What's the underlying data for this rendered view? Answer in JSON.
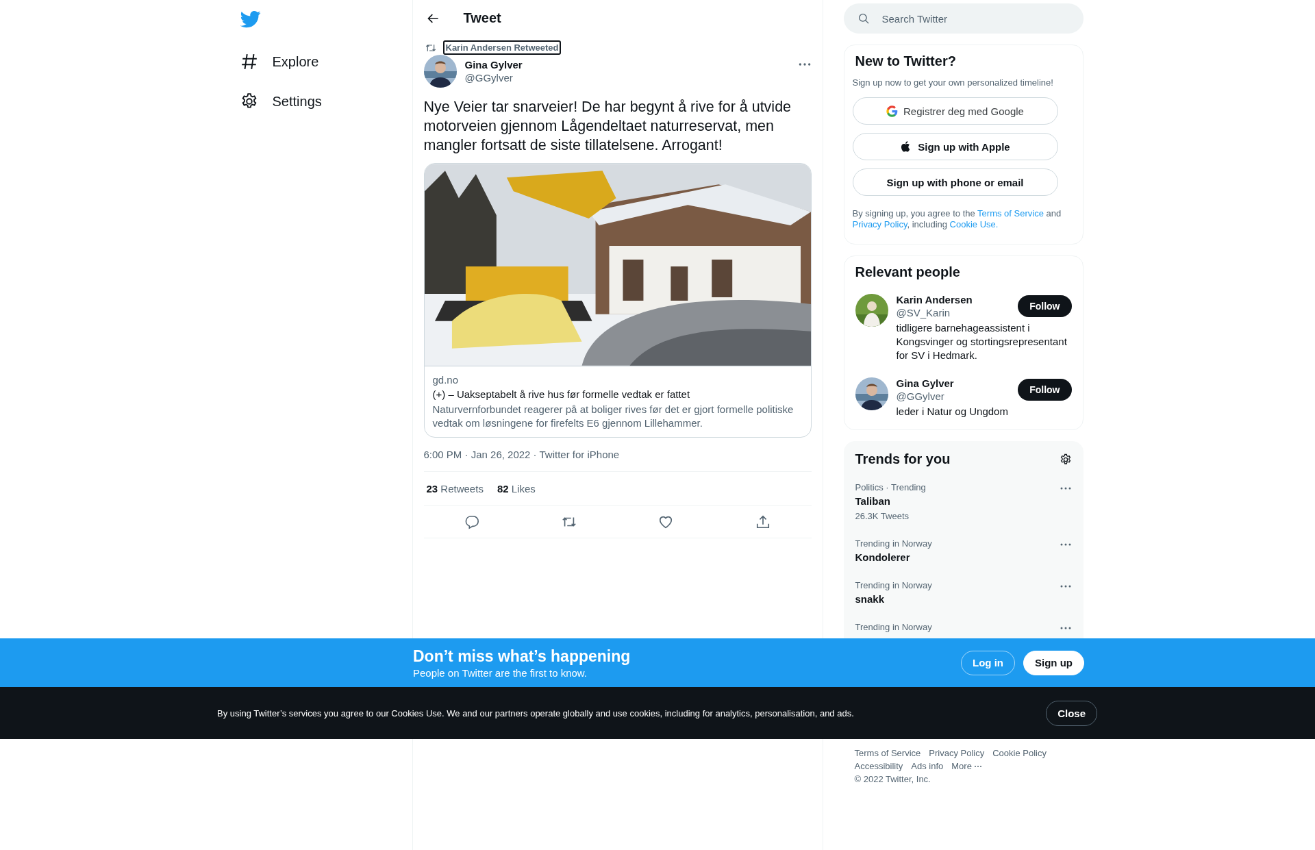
{
  "nav": {
    "items": [
      {
        "kind": "hashtag",
        "label": "Explore"
      },
      {
        "kind": "gear",
        "label": "Settings"
      }
    ]
  },
  "header": {
    "title": "Tweet"
  },
  "tweet": {
    "social_context": {
      "text": "Karin Andersen Retweeted",
      "focused": true
    },
    "author": {
      "name": "Gina Gylver",
      "handle": "@GGylver"
    },
    "text": "Nye Veier tar snarveier! De har begynt å rive for å utvide motorveien gjennom Lågendeltaet naturreservat, men mangler fortsatt de siste tillatelsene. Arrogant!",
    "card": {
      "domain": "gd.no",
      "title": "(+) – Uakseptabelt å rive hus før formelle vedtak er fattet",
      "description": "Naturvernforbundet reagerer på at boliger rives før det er gjort formelle politiske vedtak om løsningene for firefelts E6 gjennom Lillehammer."
    },
    "meta": "6:00 PM · Jan 26, 2022 · Twitter for iPhone",
    "stats": [
      "**23** Retweets",
      "**82** Likes"
    ]
  },
  "search": {
    "placeholder": "Search Twitter"
  },
  "signup": {
    "title": "New to Twitter?",
    "subtitle": "Sign up now to get your own personalized timeline!",
    "buttons": [
      {
        "kind": "google",
        "label": "Registrer deg med Google"
      },
      {
        "kind": "apple",
        "label": "Sign up with Apple"
      },
      {
        "kind": "plain",
        "label": "Sign up with phone or email"
      }
    ],
    "legal": [
      {
        "kind": "text",
        "text": "By signing up, you agree to the "
      },
      {
        "kind": "link",
        "text": "Terms of Service"
      },
      {
        "kind": "text",
        "text": " and "
      },
      {
        "kind": "link",
        "text": "Privacy Policy"
      },
      {
        "kind": "text",
        "text": ", including "
      },
      {
        "kind": "link",
        "text": "Cookie Use."
      }
    ]
  },
  "relevant_people": {
    "title": "Relevant people",
    "people": [
      {
        "name": "Karin Andersen",
        "handle": "@SV_Karin",
        "bio": "tidligere barnehageassistent i Kongsvinger og stortingsrepresentant for SV i Hedmark.",
        "follow": "Follow"
      },
      {
        "name": "Gina Gylver",
        "handle": "@GGylver",
        "bio": "leder i Natur og Ungdom",
        "follow": "Follow"
      }
    ]
  },
  "trends": {
    "title": "Trends for you",
    "items": [
      {
        "context": "Politics · Trending",
        "topic": "Taliban",
        "count": "26.3K Tweets"
      },
      {
        "context": "Trending in Norway",
        "topic": "Kondolerer"
      },
      {
        "context": "Trending in Norway",
        "topic": "snakk"
      },
      {
        "context": "Trending in Norway"
      }
    ]
  },
  "footer": {
    "links": [
      "Terms of Service",
      "Privacy Policy",
      "Cookie Policy",
      "Accessibility",
      "Ads info",
      "More"
    ],
    "copyright": "© 2022 Twitter, Inc."
  },
  "banner": {
    "title": "Don’t miss what’s happening",
    "subtitle": "People on Twitter are the first to know.",
    "buttons": [
      {
        "kind": "outline",
        "label": "Log in"
      },
      {
        "kind": "filled",
        "label": "Sign up"
      }
    ]
  },
  "cookie": {
    "text": "By using Twitter’s services you agree to our Cookies Use. We and our partners operate globally and use cookies, including for analytics, personalisation, and ads.",
    "button": "Close"
  }
}
